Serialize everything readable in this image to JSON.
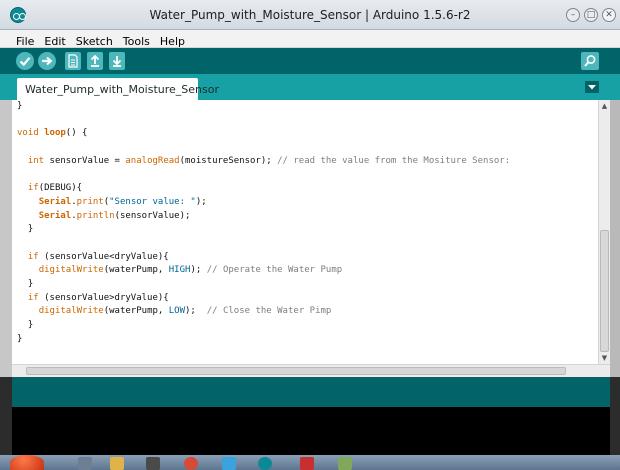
{
  "window": {
    "title": "Water_Pump_with_Moisture_Sensor | Arduino 1.5.6-r2"
  },
  "menu": [
    "File",
    "Edit",
    "Sketch",
    "Tools",
    "Help"
  ],
  "toolbar": {
    "buttons": [
      "verify-icon",
      "upload-icon",
      "new-icon",
      "open-icon",
      "save-icon",
      "serial-monitor-icon"
    ]
  },
  "tab": {
    "label": "Water_Pump_with_Moisture_Sensor"
  },
  "code": {
    "l01": "}",
    "l02": "",
    "l03_kw": "void",
    "l03_fn": "loop",
    "l03_rest": "() {",
    "l04": "",
    "l05_ty": "int",
    "l05_a": " sensorValue = ",
    "l05_fn": "analogRead",
    "l05_b": "(moistureSensor);",
    "l05_cmt": " // read the value from the Mositure Sensor:",
    "l06": "",
    "l07_kw": "if",
    "l07_rest": "(DEBUG){",
    "l08_obj": "Serial",
    "l08_fn": "print",
    "l08_a": "(",
    "l08_str": "\"Sensor value: \"",
    "l08_b": ");",
    "l09_obj": "Serial",
    "l09_fn": "println",
    "l09_rest": "(sensorValue);",
    "l10": "}",
    "l11": "",
    "l12_kw": "if",
    "l12_rest": " (sensorValue<dryValue){",
    "l13_fn": "digitalWrite",
    "l13_a": "(waterPump, ",
    "l13_const": "HIGH",
    "l13_b": "); ",
    "l13_cmt": "// Operate the Water Pump",
    "l14": "}",
    "l15_kw": "if",
    "l15_rest": " (sensorValue>dryValue){",
    "l16_fn": "digitalWrite",
    "l16_a": "(waterPump, ",
    "l16_const": "LOW",
    "l16_b": ");  ",
    "l16_cmt": "// Close the Water Pimp",
    "l17": "}",
    "l18": "}"
  },
  "colors": {
    "toolbar_bg": "#006468",
    "tabbar_bg": "#17a1a5",
    "keyword": "#cc6600",
    "constant": "#006699",
    "comment": "#7e7e7e",
    "console_bg": "#000000"
  }
}
